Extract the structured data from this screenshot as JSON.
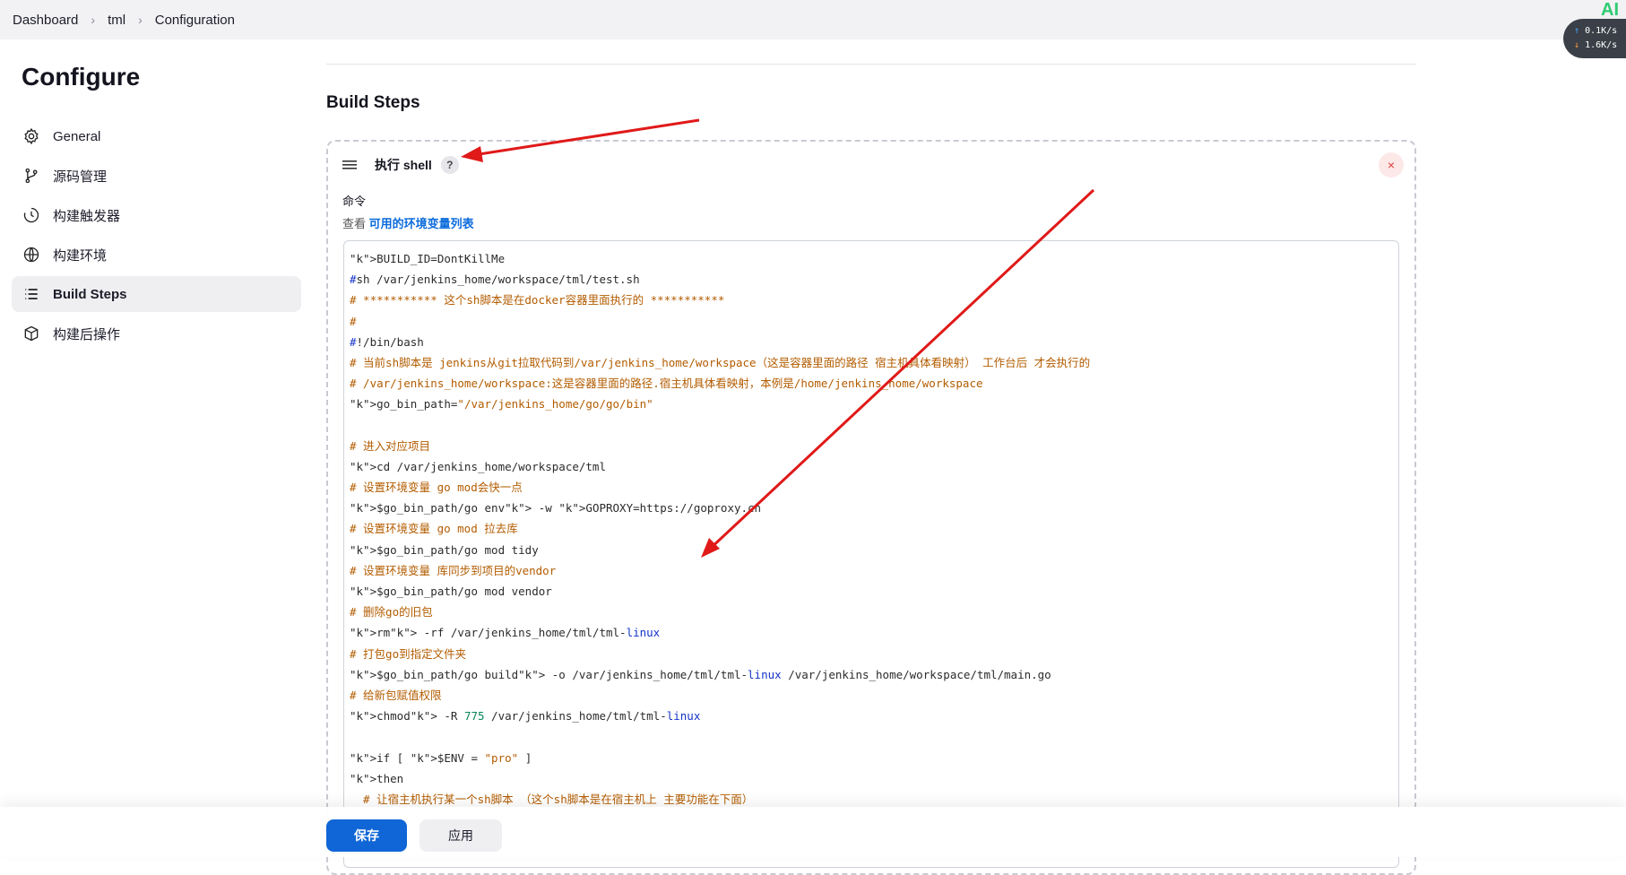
{
  "breadcrumb": {
    "items": [
      "Dashboard",
      "tml",
      "Configuration"
    ]
  },
  "speed": {
    "up": "0.1",
    "down": "1.6",
    "unit": "K/s",
    "badge": "AI"
  },
  "sidebar": {
    "title": "Configure",
    "items": [
      {
        "label": "General",
        "icon": "gear-icon"
      },
      {
        "label": "源码管理",
        "icon": "branch-icon"
      },
      {
        "label": "构建触发器",
        "icon": "clock-icon"
      },
      {
        "label": "构建环境",
        "icon": "globe-icon"
      },
      {
        "label": "Build Steps",
        "icon": "list-icon",
        "active": true
      },
      {
        "label": "构建后操作",
        "icon": "box-icon"
      }
    ]
  },
  "main": {
    "section_title": "Build Steps",
    "step": {
      "title": "执行 shell",
      "help": "?",
      "close": "×",
      "field_label": "命令",
      "env_prefix": "查看",
      "env_link": "可用的环境变量列表"
    },
    "code": [
      "BUILD_ID=DontKillMe",
      "#sh /var/jenkins_home/workspace/tml/test.sh",
      "# *********** 这个sh脚本是在docker容器里面执行的 ***********",
      "#",
      "#!/bin/bash",
      "# 当前sh脚本是 jenkins从git拉取代码到/var/jenkins_home/workspace（这是容器里面的路径 宿主机具体看映射） 工作台后 才会执行的",
      "# /var/jenkins_home/workspace:这是容器里面的路径.宿主机具体看映射，本例是/home/jenkins_home/workspace",
      "go_bin_path=\"/var/jenkins_home/go/go/bin\"",
      "",
      "# 进入对应项目",
      "cd /var/jenkins_home/workspace/tml",
      "# 设置环境变量 go mod会快一点",
      "$go_bin_path/go env -w GOPROXY=https://goproxy.cn",
      "# 设置环境变量 go mod 拉去库",
      "$go_bin_path/go mod tidy",
      "# 设置环境变量 库同步到项目的vendor",
      "$go_bin_path/go mod vendor",
      "# 删除go的旧包",
      "rm -rf /var/jenkins_home/tml/tml-linux",
      "# 打包go到指定文件夹",
      "$go_bin_path/go build -o /var/jenkins_home/tml/tml-linux /var/jenkins_home/workspace/tml/main.go",
      "# 给新包赋值权限",
      "chmod -R 775 /var/jenkins_home/tml/tml-linux",
      "",
      "if [ $ENV = \"pro\" ]",
      "then",
      "  # 让宿主机执行某一个sh脚本 （这个sh脚本是在宿主机上 主要功能在下面）"
    ]
  },
  "footer": {
    "save": "保存",
    "apply": "应用"
  },
  "colors": {
    "primary": "#1066d6",
    "annotation": "#e01919",
    "keyword": "#1533c9",
    "comment": "#b35c00"
  }
}
